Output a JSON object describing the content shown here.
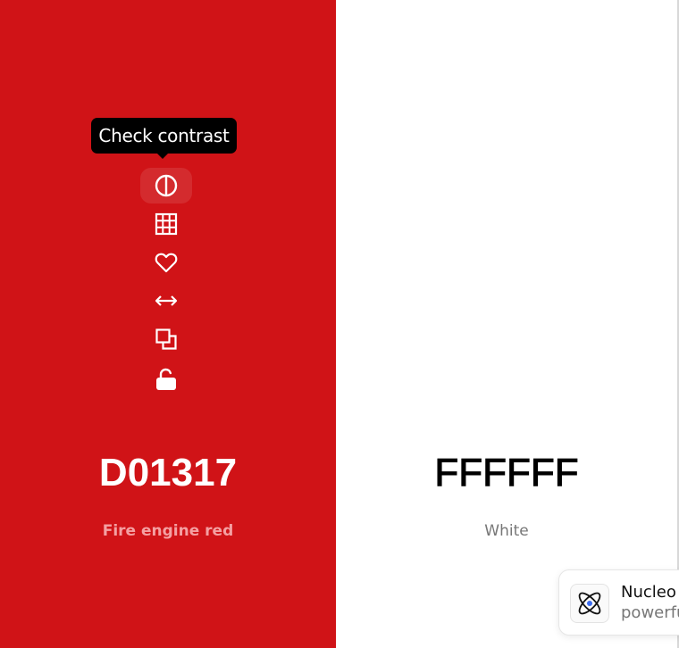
{
  "colors": {
    "left": {
      "hex": "D01317",
      "name": "Fire engine red",
      "background": "#D01317"
    },
    "right": {
      "hex": "FFFFFF",
      "name": "White",
      "background": "#FFFFFF"
    }
  },
  "tooltip": {
    "text": "Check contrast"
  },
  "toolbar": {
    "icons": [
      "contrast-icon",
      "grid-icon",
      "heart-icon",
      "arrows-horizontal-icon",
      "copy-icon",
      "unlock-icon"
    ]
  },
  "promo": {
    "title": "Nucleo",
    "subtitle": "powerfu",
    "icon": "atom-icon"
  }
}
